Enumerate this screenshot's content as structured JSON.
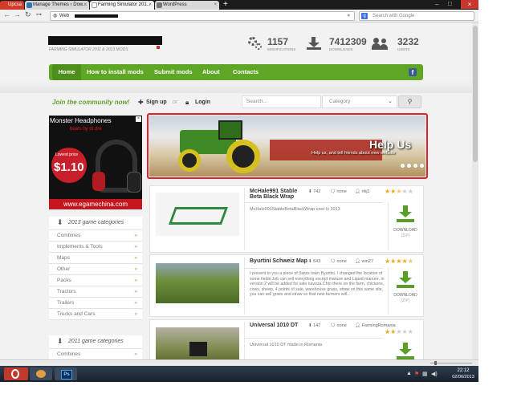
{
  "tabs": [
    {
      "label": "Upcsa"
    },
    {
      "label": "Manage Themes ‹ Dow..."
    },
    {
      "label": "Farming Simulator 201..."
    },
    {
      "label": "WordPress"
    }
  ],
  "address": {
    "scheme": "Web"
  },
  "google_search": {
    "placeholder": "Search with Google"
  },
  "site": {
    "tagline": "FARMING SIMULATOR 2011 & 2013 MODS",
    "stats": [
      {
        "value": "1157",
        "label": "MODIFICATIONS"
      },
      {
        "value": "7412309",
        "label": "DOWNLOADS"
      },
      {
        "value": "3232",
        "label": "USERS"
      }
    ]
  },
  "menu": [
    "Home",
    "How to install mods",
    "Submit mods",
    "About",
    "Contacts"
  ],
  "community": {
    "join": "Join the community now!",
    "signup": "Sign up",
    "or": "or",
    "login": "Login",
    "search_placeholder": "Search...",
    "category": "Category"
  },
  "banner": {
    "title": "Help Us",
    "subtitle": "Help us, and tell friends about new website"
  },
  "ad": {
    "title": "Monster Headphones",
    "brand": "beats by dr.dre",
    "price_label": "Lowest price",
    "price": "$1.10",
    "url": "www.egamechina.com"
  },
  "cat2013": {
    "title": "2013 game categories",
    "items": [
      "Combines",
      "Implements & Tools",
      "Maps",
      "Other",
      "Packs",
      "Tractors",
      "Trailers",
      "Trucks and Cars"
    ]
  },
  "cat2011": {
    "title": "2011 game categories",
    "items": [
      "Combines"
    ]
  },
  "mods": [
    {
      "title": "McHale991 Stable Beta Black Wrap",
      "downloads": "742",
      "comments": "none",
      "author": "rikj1",
      "rating": 2.5,
      "desc": "McHale991StableBetaBlackWrap voor ls 2013",
      "dl_label": "DOWNLOAD",
      "dl_type": "(ZIP)"
    },
    {
      "title": "Byurtini Schweiz Map",
      "downloads": "543",
      "comments": "none",
      "author": "win27",
      "rating": 4.5,
      "desc": "I present to you a piece of Swiss town Byurtini, I changed the location of some fields.Job can sell everything except manure and Liquid manure, in version 2 will be added for sale navoza.Chto there on the farm, chickens, cows, sheep, 4 points of sale, warehouse grass, straw on this same site, you can sell grass and straw so that new farmers will...",
      "dl_label": "DOWNLOAD",
      "dl_type": "(ZIP)"
    },
    {
      "title": "Universal 1010 DT",
      "downloads": "147",
      "comments": "none",
      "author": "FarmingRomania",
      "rating": 2,
      "desc": "Universal 1010 DT made in Romania",
      "dl_label": "",
      "dl_type": ""
    }
  ],
  "clock": {
    "time": "22:12",
    "date": "02/06/2013"
  },
  "colors": {
    "accent_green": "#5fa624",
    "banner_border": "#e0202a",
    "star": "#f0a81c"
  }
}
